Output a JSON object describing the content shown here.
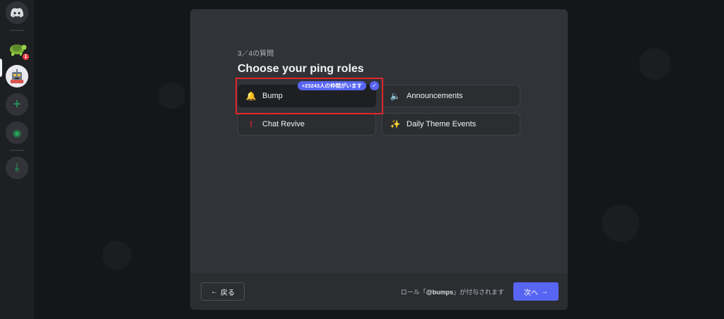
{
  "rail": {
    "badge_count": "1",
    "items": [
      {
        "name": "discord-home-icon"
      },
      {
        "name": "server-turtle-icon"
      },
      {
        "name": "server-robot-icon"
      },
      {
        "name": "add-server-icon",
        "glyph": "+"
      },
      {
        "name": "explore-compass-icon",
        "glyph": "◉"
      },
      {
        "name": "download-icon",
        "glyph": "⤓"
      }
    ]
  },
  "onboarding": {
    "step": "3／4の質問",
    "title": "Choose your ping roles",
    "options": [
      {
        "label": "Bump",
        "icon": "bell-icon",
        "glyph": "🔔",
        "selected": true
      },
      {
        "label": "Announcements",
        "icon": "speaker-icon",
        "glyph": "🔈",
        "selected": false
      },
      {
        "label": "Chat Revive",
        "icon": "exclamation-icon",
        "glyph": "!",
        "selected": false
      },
      {
        "label": "Daily Theme Events",
        "icon": "sparkle-icon",
        "glyph": "✨",
        "selected": false
      }
    ],
    "member_pill": "+23243人の仲間がいます",
    "check_glyph": "✓"
  },
  "footer": {
    "back_label": "戻る",
    "back_arrow": "←",
    "hint_prefix": "ロール「",
    "hint_role": "@bumps",
    "hint_suffix": "」が付与されます",
    "next_label": "次へ",
    "next_arrow": "→"
  },
  "colors": {
    "accent": "#5865f2",
    "highlight_box": "#e1262c",
    "modal_bg": "#313338"
  }
}
